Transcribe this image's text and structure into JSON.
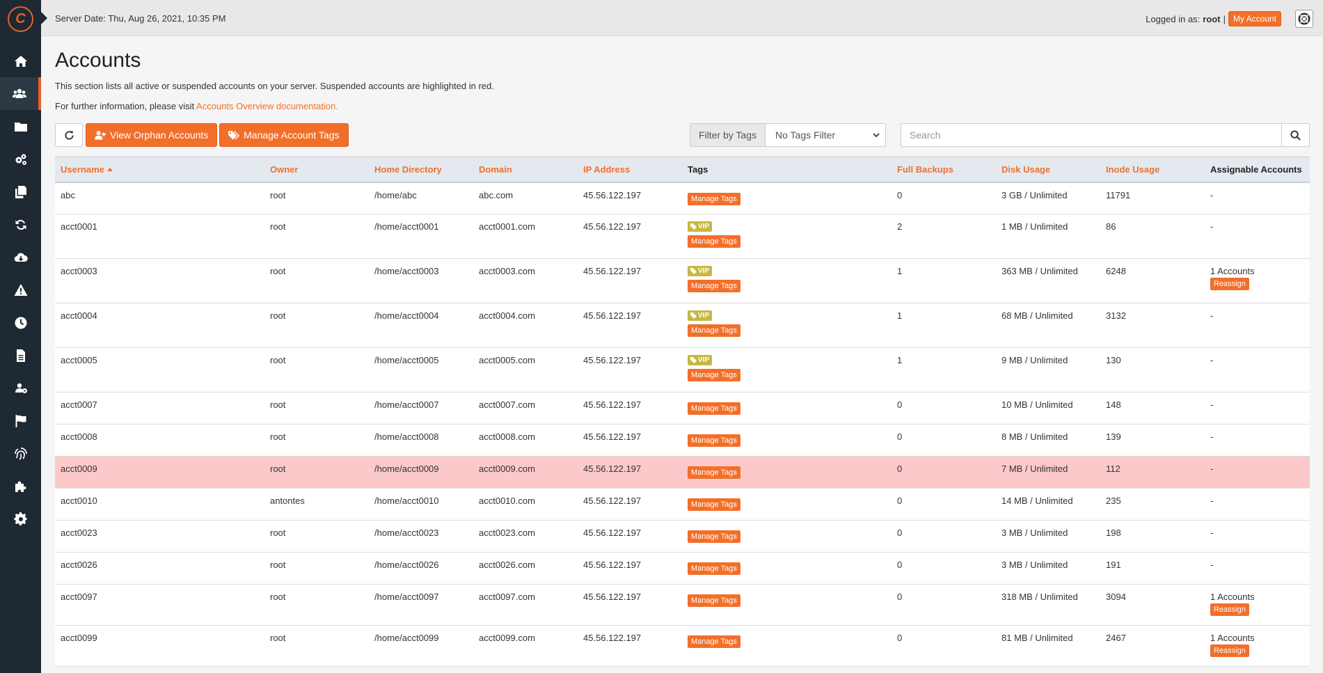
{
  "topbar": {
    "server_date": "Server Date: Thu, Aug 26, 2021, 10:35 PM",
    "logged_in_label": "Logged in as:",
    "username": "root",
    "separator": "|",
    "my_account": "My Account"
  },
  "sidebar": {
    "items": [
      {
        "icon": "home-icon"
      },
      {
        "icon": "users-icon",
        "active": true
      },
      {
        "icon": "folder-icon"
      },
      {
        "icon": "cogs-icon"
      },
      {
        "icon": "copy-icon"
      },
      {
        "icon": "sync-icon"
      },
      {
        "icon": "cloud-download-icon"
      },
      {
        "icon": "warning-icon"
      },
      {
        "icon": "clock-icon"
      },
      {
        "icon": "file-icon"
      },
      {
        "icon": "users-cog-icon"
      },
      {
        "icon": "flag-icon"
      },
      {
        "icon": "fingerprint-icon"
      },
      {
        "icon": "puzzle-icon"
      },
      {
        "icon": "gear-icon"
      }
    ]
  },
  "page": {
    "title": "Accounts",
    "description": "This section lists all active or suspended accounts on your server. Suspended accounts are highlighted in red.",
    "info_prefix": "For further information, please visit ",
    "info_link": "Accounts Overview documentation."
  },
  "toolbar": {
    "view_orphan": "View Orphan Accounts",
    "manage_tags": "Manage Account Tags",
    "filter_label": "Filter by Tags",
    "filter_value": "No Tags Filter",
    "search_placeholder": "Search"
  },
  "table": {
    "columns": [
      "Username",
      "Owner",
      "Home Directory",
      "Domain",
      "IP Address",
      "Tags",
      "Full Backups",
      "Disk Usage",
      "Inode Usage",
      "Assignable Accounts"
    ],
    "manage_tags_label": "Manage Tags",
    "vip_label": "VIP",
    "reassign_label": "Reassign",
    "rows": [
      {
        "username": "abc",
        "owner": "root",
        "home": "/home/abc",
        "domain": "abc.com",
        "ip": "45.56.122.197",
        "vip": false,
        "backups": "0",
        "disk": "3 GB / Unlimited",
        "inode": "11791",
        "assignable": "-",
        "reassign": false,
        "suspended": false
      },
      {
        "username": "acct0001",
        "owner": "root",
        "home": "/home/acct0001",
        "domain": "acct0001.com",
        "ip": "45.56.122.197",
        "vip": true,
        "backups": "2",
        "disk": "1 MB / Unlimited",
        "inode": "86",
        "assignable": "-",
        "reassign": false,
        "suspended": false
      },
      {
        "username": "acct0003",
        "owner": "root",
        "home": "/home/acct0003",
        "domain": "acct0003.com",
        "ip": "45.56.122.197",
        "vip": true,
        "backups": "1",
        "disk": "363 MB / Unlimited",
        "inode": "6248",
        "assignable": "1 Accounts",
        "reassign": true,
        "suspended": false
      },
      {
        "username": "acct0004",
        "owner": "root",
        "home": "/home/acct0004",
        "domain": "acct0004.com",
        "ip": "45.56.122.197",
        "vip": true,
        "backups": "1",
        "disk": "68 MB / Unlimited",
        "inode": "3132",
        "assignable": "-",
        "reassign": false,
        "suspended": false
      },
      {
        "username": "acct0005",
        "owner": "root",
        "home": "/home/acct0005",
        "domain": "acct0005.com",
        "ip": "45.56.122.197",
        "vip": true,
        "backups": "1",
        "disk": "9 MB / Unlimited",
        "inode": "130",
        "assignable": "-",
        "reassign": false,
        "suspended": false
      },
      {
        "username": "acct0007",
        "owner": "root",
        "home": "/home/acct0007",
        "domain": "acct0007.com",
        "ip": "45.56.122.197",
        "vip": false,
        "backups": "0",
        "disk": "10 MB / Unlimited",
        "inode": "148",
        "assignable": "-",
        "reassign": false,
        "suspended": false
      },
      {
        "username": "acct0008",
        "owner": "root",
        "home": "/home/acct0008",
        "domain": "acct0008.com",
        "ip": "45.56.122.197",
        "vip": false,
        "backups": "0",
        "disk": "8 MB / Unlimited",
        "inode": "139",
        "assignable": "-",
        "reassign": false,
        "suspended": false
      },
      {
        "username": "acct0009",
        "owner": "root",
        "home": "/home/acct0009",
        "domain": "acct0009.com",
        "ip": "45.56.122.197",
        "vip": false,
        "backups": "0",
        "disk": "7 MB / Unlimited",
        "inode": "112",
        "assignable": "-",
        "reassign": false,
        "suspended": true
      },
      {
        "username": "acct0010",
        "owner": "antontes",
        "home": "/home/acct0010",
        "domain": "acct0010.com",
        "ip": "45.56.122.197",
        "vip": false,
        "backups": "0",
        "disk": "14 MB / Unlimited",
        "inode": "235",
        "assignable": "-",
        "reassign": false,
        "suspended": false
      },
      {
        "username": "acct0023",
        "owner": "root",
        "home": "/home/acct0023",
        "domain": "acct0023.com",
        "ip": "45.56.122.197",
        "vip": false,
        "backups": "0",
        "disk": "3 MB / Unlimited",
        "inode": "198",
        "assignable": "-",
        "reassign": false,
        "suspended": false
      },
      {
        "username": "acct0026",
        "owner": "root",
        "home": "/home/acct0026",
        "domain": "acct0026.com",
        "ip": "45.56.122.197",
        "vip": false,
        "backups": "0",
        "disk": "3 MB / Unlimited",
        "inode": "191",
        "assignable": "-",
        "reassign": false,
        "suspended": false
      },
      {
        "username": "acct0097",
        "owner": "root",
        "home": "/home/acct0097",
        "domain": "acct0097.com",
        "ip": "45.56.122.197",
        "vip": false,
        "backups": "0",
        "disk": "318 MB / Unlimited",
        "inode": "3094",
        "assignable": "1 Accounts",
        "reassign": true,
        "suspended": false
      },
      {
        "username": "acct0099",
        "owner": "root",
        "home": "/home/acct0099",
        "domain": "acct0099.com",
        "ip": "45.56.122.197",
        "vip": false,
        "backups": "0",
        "disk": "81 MB / Unlimited",
        "inode": "2467",
        "assignable": "1 Accounts",
        "reassign": true,
        "suspended": false
      }
    ]
  },
  "colors": {
    "accent": "#f26f2a",
    "sidebar_bg": "#1f2933",
    "suspended_row": "#fcc9ca",
    "vip_badge": "#c7b843"
  }
}
